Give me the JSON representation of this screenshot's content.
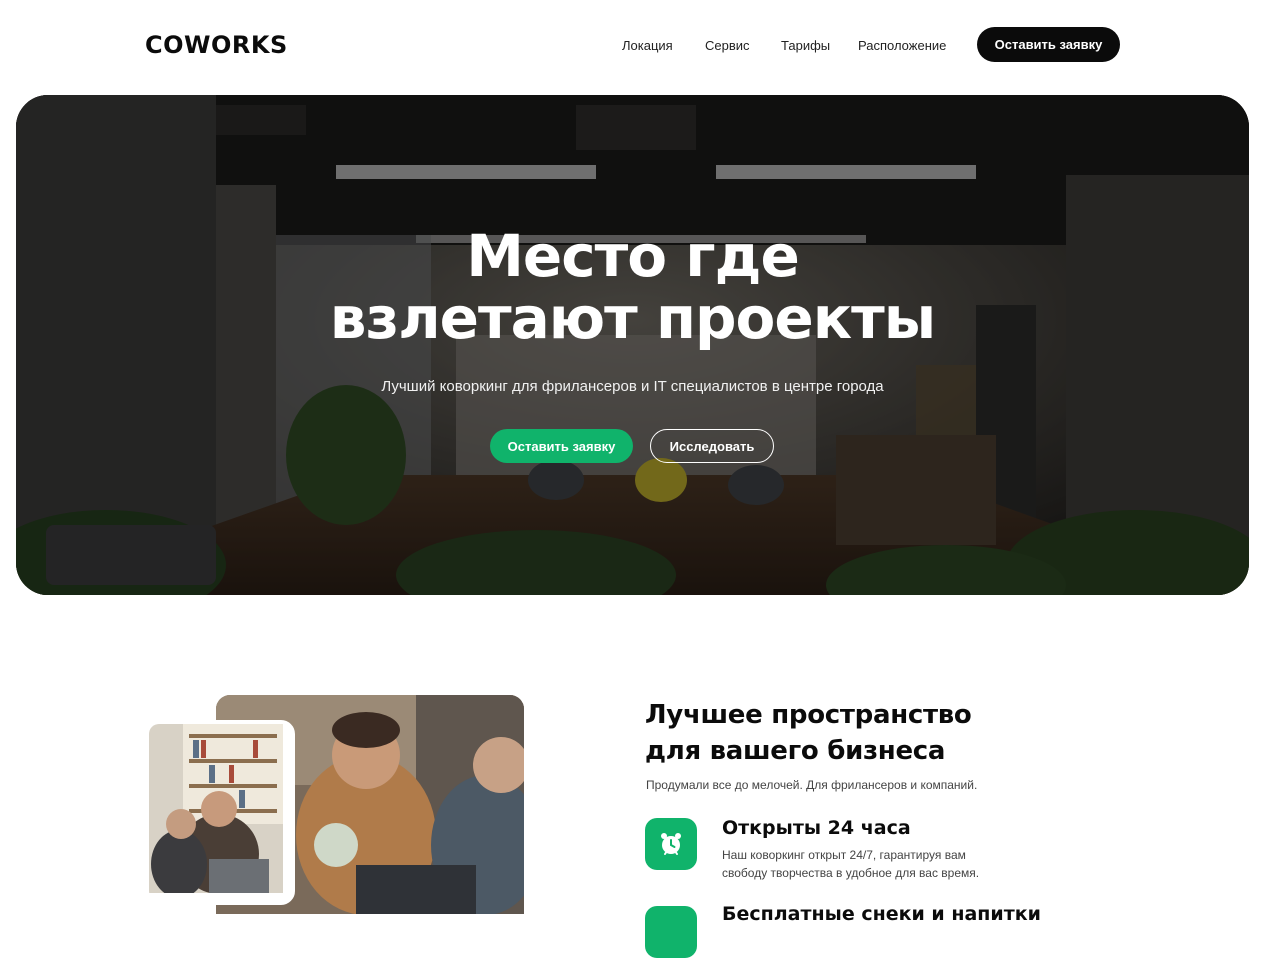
{
  "header": {
    "logo": "COWORKS",
    "nav": [
      "Локация",
      "Сервис",
      "Тарифы",
      "Расположение"
    ],
    "cta": "Оставить заявку"
  },
  "hero": {
    "title_line1": "Место где",
    "title_line2": "взлетают проекты",
    "subtitle": "Лучший коворкинг для фрилансеров и IT специалистов в центре города",
    "primary_button": "Оставить заявку",
    "secondary_button": "Исследовать"
  },
  "features": {
    "title_line1": "Лучшее пространство",
    "title_line2": "для вашего бизнеса",
    "subtitle": "Продумали все до мелочей. Для фрилансеров и компаний.",
    "items": [
      {
        "icon": "alarm-clock-icon",
        "title": "Открыты 24 часа",
        "description_line1": "Наш коворкинг открыт 24/7, гарантируя вам",
        "description_line2": "свободу творчества в удобное для вас время."
      },
      {
        "icon": "coffee-icon",
        "title": "Бесплатные снеки и напитки"
      }
    ]
  },
  "colors": {
    "accent": "#10b36b",
    "dark": "#0b0b0b"
  }
}
